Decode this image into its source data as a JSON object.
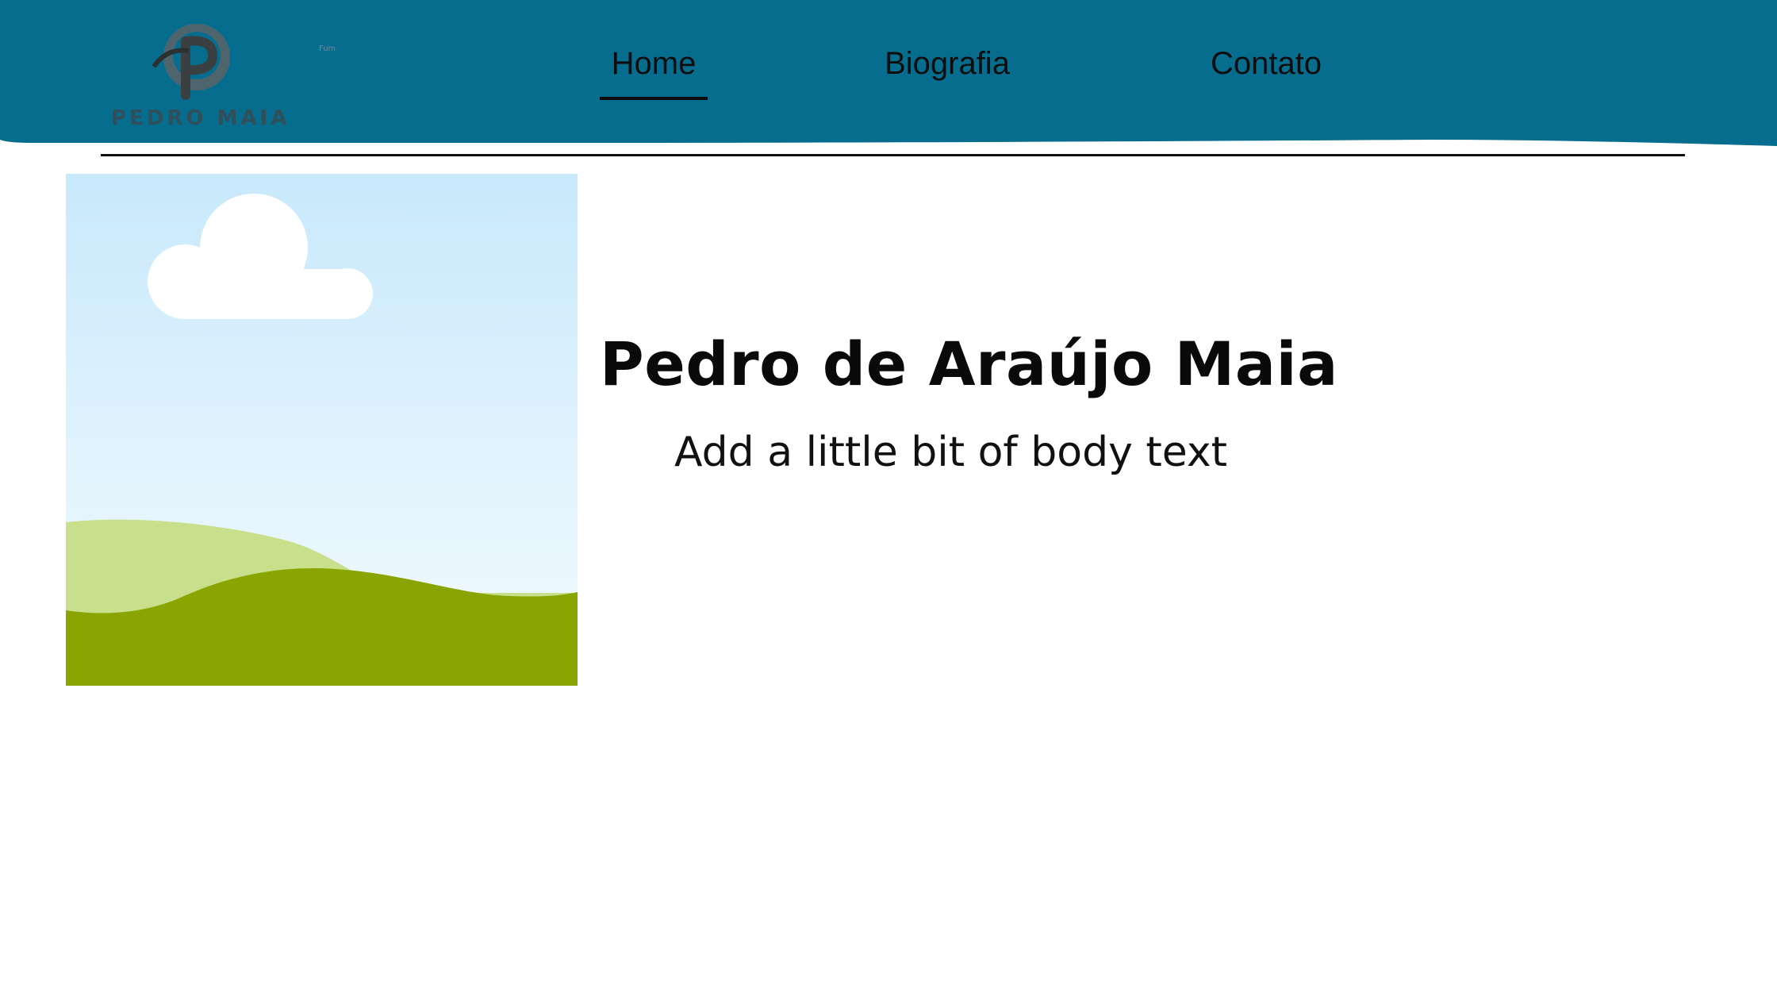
{
  "header": {
    "logo_text": "PEDRO MAIA",
    "logo_letter": "P",
    "background_color": "#076d8e"
  },
  "nav": {
    "items": [
      {
        "label": "Home",
        "active": true
      },
      {
        "label": "Biografia",
        "active": false
      },
      {
        "label": "Contato",
        "active": false
      }
    ]
  },
  "hero": {
    "title": "Pedro de Araújo Maia",
    "body": "Add a little bit of body text",
    "image_icon": "landscape-placeholder-icon"
  },
  "colors": {
    "header_blue": "#076d8e",
    "sky_top": "#c8e9fc",
    "sky_bottom": "#eff9fd",
    "hill_light": "#c8e08b",
    "hill_dark": "#8aa502",
    "cloud": "#ffffff",
    "text": "#0a0a0a"
  }
}
